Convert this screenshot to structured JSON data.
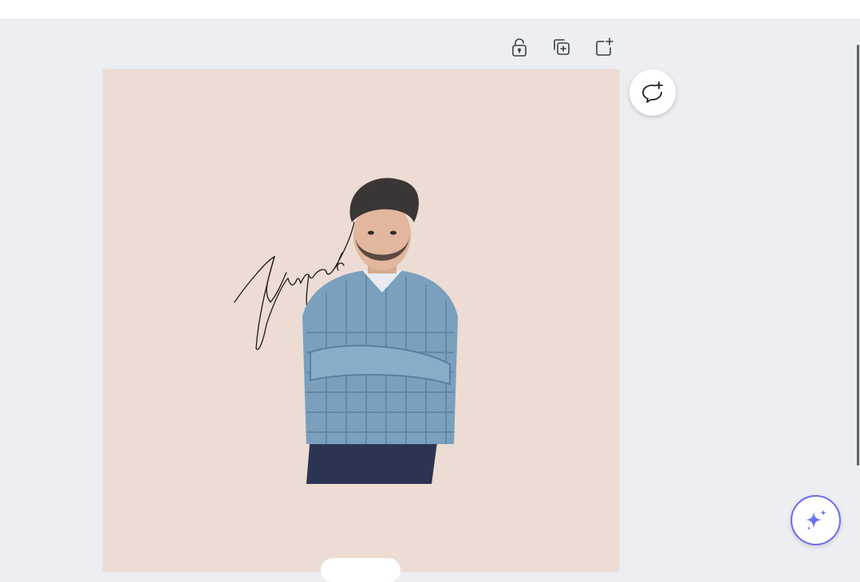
{
  "page": {
    "canvas_background": "#ecdcd4",
    "workspace_background": "#eceef1"
  },
  "toolbar": {
    "buttons": [
      {
        "name": "lock-icon",
        "label": ""
      },
      {
        "name": "duplicate-page-icon",
        "label": ""
      },
      {
        "name": "add-page-icon",
        "label": ""
      }
    ]
  },
  "canvas": {
    "signature_text": "Yuvpreet",
    "photo_description_icon": "person-photo"
  },
  "fab": {
    "comment_icon": "comment-add-icon",
    "ai_icon": "sparkles-icon",
    "ai_accent": "#6b6cf0"
  }
}
